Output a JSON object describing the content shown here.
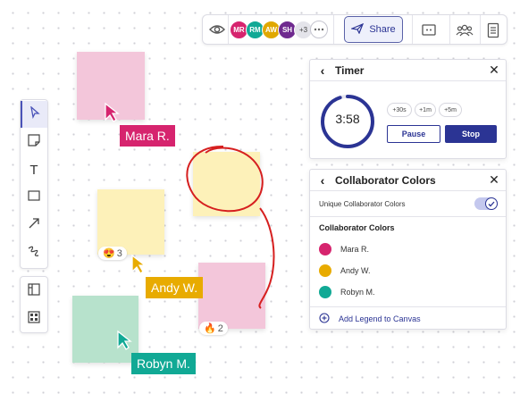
{
  "toolbar": {
    "avatars": [
      {
        "initials": "MR",
        "color": "#d6246e"
      },
      {
        "initials": "RM",
        "color": "#11a995"
      },
      {
        "initials": "AW",
        "color": "#e0a800"
      },
      {
        "initials": "SH",
        "color": "#6f2a8f"
      }
    ],
    "more_count": "+3",
    "share_label": "Share",
    "icons": [
      "eye-icon",
      "chat-icon",
      "share-plane-icon",
      "comment-icon",
      "people-icon",
      "notes-icon"
    ]
  },
  "tools": {
    "items": [
      "select-tool",
      "sticky-note-tool",
      "text-tool",
      "shape-tool",
      "arrow-tool",
      "pen-tool"
    ],
    "text_tool_glyph": "T",
    "extra": [
      "layout-tool",
      "grid-tool"
    ]
  },
  "canvas": {
    "cursors": [
      {
        "name": "Mara R.",
        "color": "#d6246e"
      },
      {
        "name": "Andy W.",
        "color": "#e8ab00"
      },
      {
        "name": "Robyn M.",
        "color": "#11a995"
      }
    ],
    "reactions": [
      {
        "emoji": "😍",
        "count": "3"
      },
      {
        "emoji": "🔥",
        "count": "2"
      }
    ],
    "sticky_colors": {
      "pink": "#f3c6da",
      "yellow": "#fdf1b9",
      "green": "#b7e2cc",
      "annotation": "#d61f1f"
    }
  },
  "timer": {
    "title": "Timer",
    "time": "3:58",
    "progress": 0.95,
    "add_options": [
      "+30s",
      "+1m",
      "+5m"
    ],
    "pause_label": "Pause",
    "stop_label": "Stop"
  },
  "colors_panel": {
    "title": "Collaborator Colors",
    "toggle_label": "Unique Collaborator  Colors",
    "toggle_on": true,
    "section_title": "Collaborator  Colors",
    "collaborators": [
      {
        "name": "Mara R.",
        "color": "#d6246e"
      },
      {
        "name": "Andy W.",
        "color": "#e8ab00"
      },
      {
        "name": "Robyn M.",
        "color": "#11a995"
      }
    ],
    "add_legend_label": "Add Legend to Canvas"
  }
}
